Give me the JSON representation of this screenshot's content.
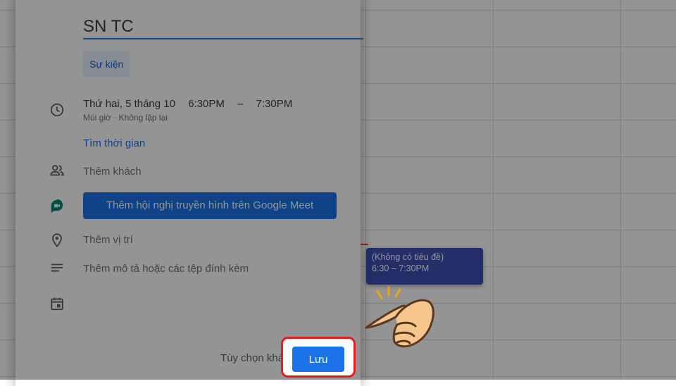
{
  "event_form": {
    "title_value": "SN TC",
    "type_chip": "Sự kiện",
    "date": "Thứ hai, 5 tháng 10",
    "start_time": "6:30PM",
    "separator": "–",
    "end_time": "7:30PM",
    "timezone_repeat": "Múi giờ · Không lặp lại",
    "find_time": "Tìm thời gian",
    "add_guests": "Thêm khách",
    "meet_button": "Thêm hội nghị truyền hình trên Google Meet",
    "add_location": "Thêm vị trí",
    "add_description": "Thêm mô tả hoặc các tệp đính kèm",
    "more_options": "Tùy chọn khác",
    "save_label": "Lưu"
  },
  "calendar_event": {
    "title": "(Không có tiêu đề)",
    "time": "6:30 – 7:30PM"
  },
  "colors": {
    "accent": "#1a73e8",
    "event": "#3f51b5",
    "highlight": "#e02020"
  }
}
